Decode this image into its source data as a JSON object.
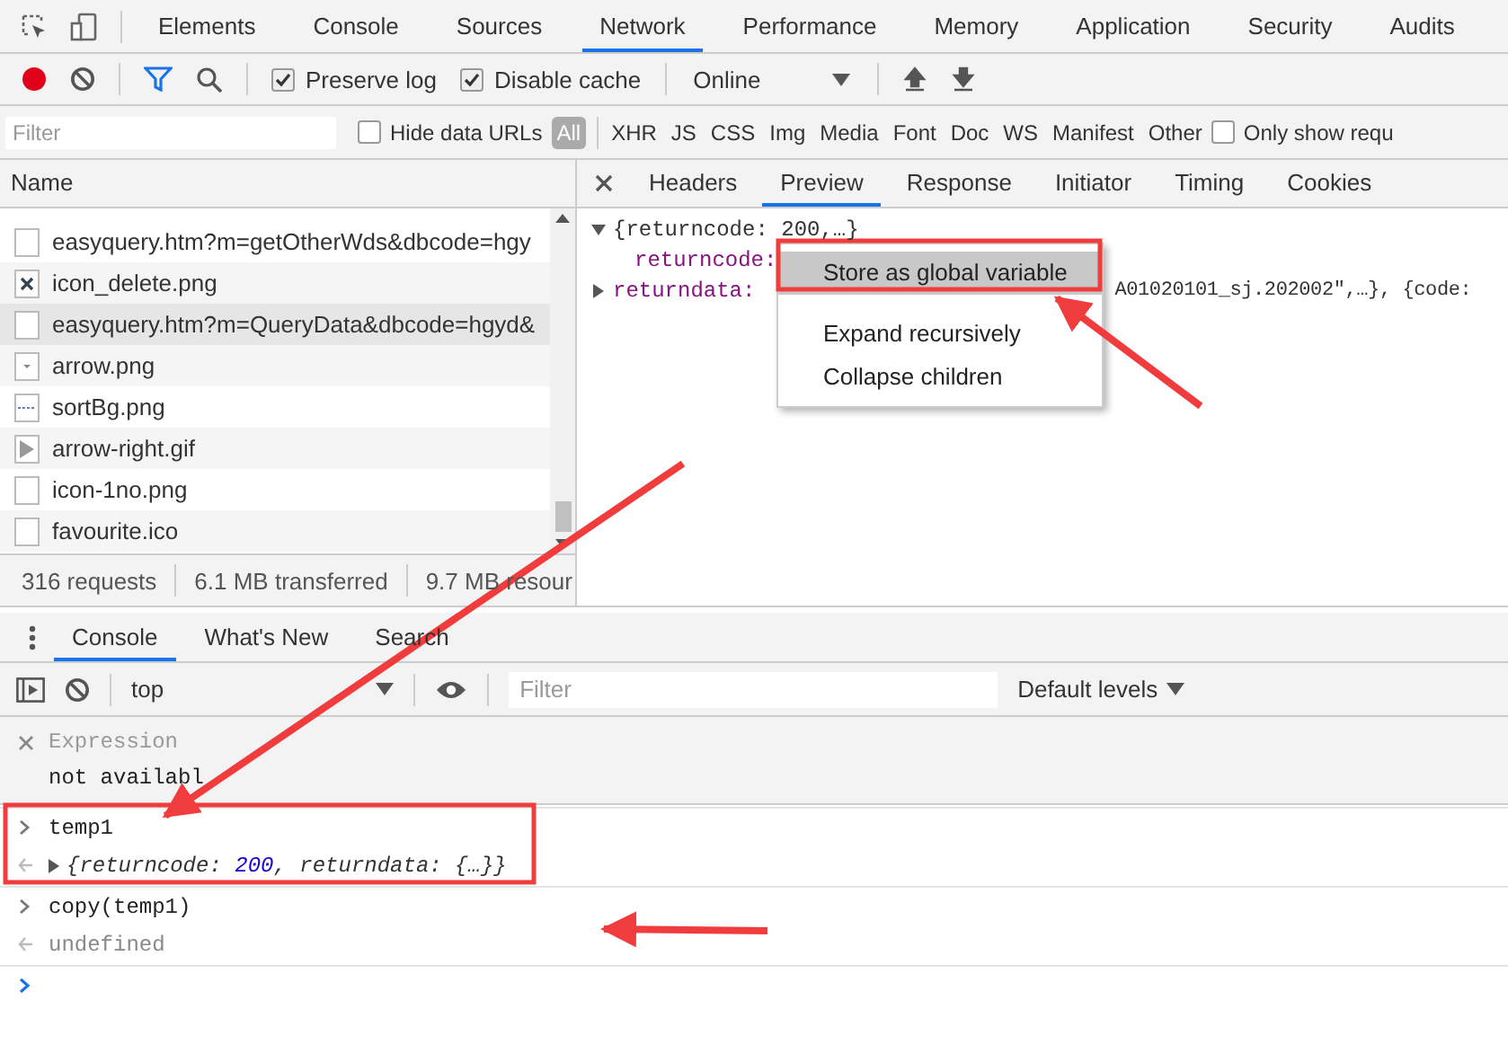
{
  "main_tabs": [
    {
      "label": "Elements",
      "selected": false
    },
    {
      "label": "Console",
      "selected": false
    },
    {
      "label": "Sources",
      "selected": false
    },
    {
      "label": "Network",
      "selected": true
    },
    {
      "label": "Performance",
      "selected": false
    },
    {
      "label": "Memory",
      "selected": false
    },
    {
      "label": "Application",
      "selected": false
    },
    {
      "label": "Security",
      "selected": false
    },
    {
      "label": "Audits",
      "selected": false
    }
  ],
  "toolbar": {
    "recording": true,
    "checks": [
      {
        "label": "Preserve log",
        "checked": true
      },
      {
        "label": "Disable cache",
        "checked": true
      }
    ],
    "throttling": "Online"
  },
  "filter_bar": {
    "placeholder": "Filter",
    "hide_data_urls": {
      "label": "Hide data URLs",
      "checked": false
    },
    "types": [
      {
        "label": "All",
        "selected": true
      },
      {
        "label": "XHR",
        "selected": false
      },
      {
        "label": "JS",
        "selected": false
      },
      {
        "label": "CSS",
        "selected": false
      },
      {
        "label": "Img",
        "selected": false
      },
      {
        "label": "Media",
        "selected": false
      },
      {
        "label": "Font",
        "selected": false
      },
      {
        "label": "Doc",
        "selected": false
      },
      {
        "label": "WS",
        "selected": false
      },
      {
        "label": "Manifest",
        "selected": false
      },
      {
        "label": "Other",
        "selected": false
      }
    ],
    "only_show": {
      "label": "Only show requ",
      "checked": false
    }
  },
  "requests": {
    "column": "Name",
    "rows": [
      {
        "name": "easyquery.htm?m=getOtherWds&dbcode=hgy",
        "selected": false
      },
      {
        "name": "icon_delete.png",
        "selected": false
      },
      {
        "name": "easyquery.htm?m=QueryData&dbcode=hgyd&",
        "selected": true
      },
      {
        "name": "arrow.png",
        "selected": false
      },
      {
        "name": "sortBg.png",
        "selected": false
      },
      {
        "name": "arrow-right.gif",
        "selected": false
      },
      {
        "name": "icon-1no.png",
        "selected": false
      },
      {
        "name": "favourite.ico",
        "selected": false
      }
    ]
  },
  "status_bar": [
    "316 requests",
    "6.1 MB transferred",
    "9.7 MB resour"
  ],
  "detail_tabs": [
    {
      "label": "Headers",
      "selected": false
    },
    {
      "label": "Preview",
      "selected": true
    },
    {
      "label": "Response",
      "selected": false
    },
    {
      "label": "Initiator",
      "selected": false
    },
    {
      "label": "Timing",
      "selected": false
    },
    {
      "label": "Cookies",
      "selected": false
    }
  ],
  "preview": [
    {
      "expanded": true,
      "text": "{returncode: 200,…}"
    },
    {
      "key": "returncode:"
    },
    {
      "expanded": false,
      "key": "returndata:",
      "text": "A01020101_sj.202002\",…}, {code:"
    }
  ],
  "context_menu": [
    {
      "kind": "item",
      "label": "Store as global variable",
      "selected": true
    },
    {
      "kind": "separator"
    },
    {
      "kind": "item",
      "label": "Expand recursively",
      "selected": false
    },
    {
      "kind": "item",
      "label": "Collapse children",
      "selected": false
    }
  ],
  "drawer_tabs": [
    {
      "label": "Console",
      "selected": true
    },
    {
      "label": "What's New",
      "selected": false
    },
    {
      "label": "Search",
      "selected": false
    }
  ],
  "console_toolbar": {
    "context": "top",
    "filter_placeholder": "Filter",
    "levels": "Default levels"
  },
  "watch": {
    "label": "Expression",
    "value": "not availabl"
  },
  "console": [
    {
      "kind": "input",
      "text": "temp1"
    },
    {
      "kind": "object",
      "before": "{returncode: ",
      "number": "200",
      "after": ", returndata: {…}}"
    },
    {
      "kind": "input",
      "text": "copy(temp1)"
    },
    {
      "kind": "result",
      "text": "undefined"
    }
  ]
}
